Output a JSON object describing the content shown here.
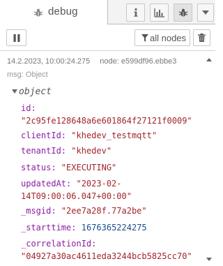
{
  "tabs": {
    "debug_label": "debug"
  },
  "toolbar": {
    "filter_label": "all nodes"
  },
  "message": {
    "timestamp": "14.2.2023, 10:00:24.275",
    "node_text": "node: e599df96.ebbe3",
    "type_text": "msg: Object",
    "object_label": "object",
    "props": [
      {
        "key": "id:",
        "value": "\"2c95fe128648a6e601864f27121f0009\"",
        "kind": "str",
        "wrap": true
      },
      {
        "key": "clientId:",
        "value": "\"khedev_testmqtt\"",
        "kind": "str",
        "wrap": false
      },
      {
        "key": "tenantId:",
        "value": "\"khedev\"",
        "kind": "str",
        "wrap": false
      },
      {
        "key": "status:",
        "value": "\"EXECUTING\"",
        "kind": "str",
        "wrap": false
      },
      {
        "key": "updatedAt:",
        "value_line1": "\"2023-02-",
        "value_line2": "14T09:00:06.047+00:00\"",
        "kind": "str",
        "wrap": true
      },
      {
        "key": "_msgid:",
        "value": "\"2ee7a28f.77a2be\"",
        "kind": "str",
        "wrap": false
      },
      {
        "key": "_starttime:",
        "value": "1676365224275",
        "kind": "num",
        "wrap": false
      },
      {
        "key": "_correlationId:",
        "value": "\"04927a30ac4611eda3244bcb5825cc70\"",
        "kind": "str",
        "wrap": true
      }
    ]
  },
  "icons": {
    "tab": "bug-icon",
    "info": "info-icon",
    "chart": "bar-chart-icon",
    "debug": "bug-icon",
    "menu": "caret-down-icon",
    "pause": "pause-icon",
    "filter": "filter-icon",
    "trash": "trash-icon"
  },
  "colors": {
    "key": "#8b1ea3",
    "string": "#a1262b",
    "number": "#1a4c8f",
    "active_button": "#e2e2e2"
  }
}
